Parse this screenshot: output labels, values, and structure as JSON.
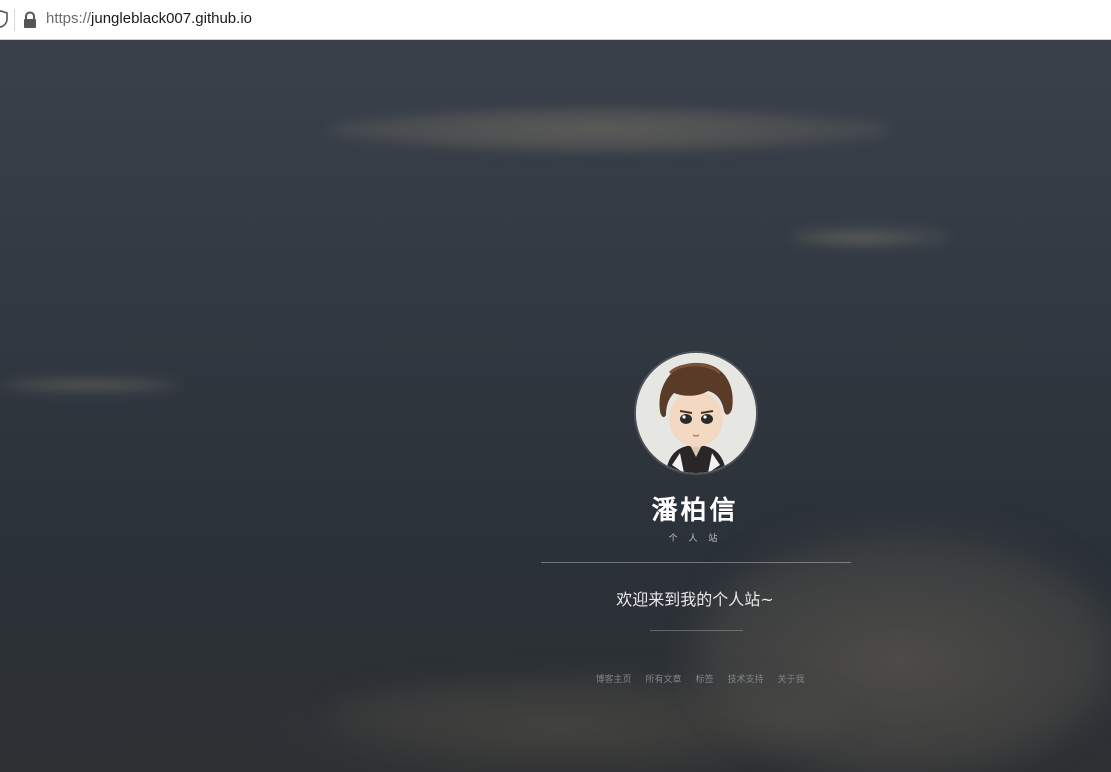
{
  "browser": {
    "url_scheme": "https://",
    "url_host": "jungleblack007.github.io"
  },
  "profile": {
    "name": "潘柏信",
    "subtitle": "个 人 站",
    "welcome": "欢迎来到我的个人站~"
  },
  "nav": {
    "items": [
      {
        "label": "博客主页"
      },
      {
        "label": "所有文章"
      },
      {
        "label": "标签"
      },
      {
        "label": "技术支持"
      },
      {
        "label": "关于我"
      }
    ]
  }
}
